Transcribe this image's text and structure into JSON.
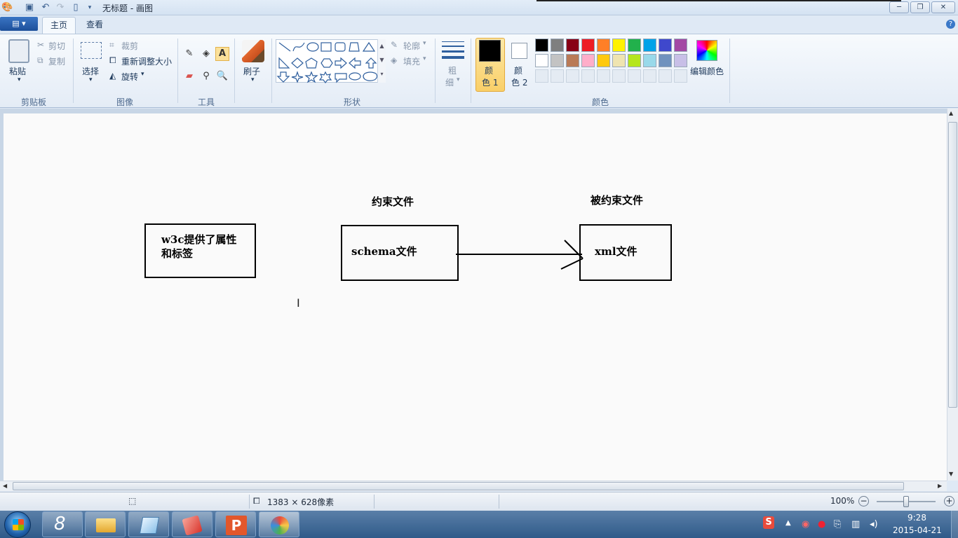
{
  "window": {
    "title": "无标题 - 画图"
  },
  "tabs": {
    "file": "▤ ▾",
    "home": "主页",
    "view": "查看"
  },
  "clipboard": {
    "paste": "粘贴",
    "cut": "剪切",
    "copy": "复制",
    "group": "剪贴板"
  },
  "image": {
    "select": "选择",
    "crop": "裁剪",
    "resize": "重新调整大小",
    "rotate": "旋转",
    "group": "图像"
  },
  "tools": {
    "group": "工具"
  },
  "brushes": {
    "label": "刷子"
  },
  "shapes": {
    "outline": "轮廓",
    "fill": "填充",
    "group": "形状"
  },
  "size": {
    "label1": "粗",
    "label2": "细"
  },
  "colors": {
    "color1_a": "颜",
    "color1_b": "色 1",
    "color2_a": "颜",
    "color2_b": "色 2",
    "edit": "编辑颜色",
    "group": "颜色",
    "color1": "#000000",
    "color2": "#ffffff",
    "palette_row1": [
      "#000000",
      "#7f7f7f",
      "#880015",
      "#ed1c24",
      "#ff7f27",
      "#fff200",
      "#22b14c",
      "#00a2e8",
      "#3f48cc",
      "#a349a4"
    ],
    "palette_row2": [
      "#ffffff",
      "#c3c3c3",
      "#b97a57",
      "#ffaec9",
      "#ffc90e",
      "#efe4b0",
      "#b5e61d",
      "#99d9ea",
      "#7092be",
      "#c8bfe7"
    ]
  },
  "drawing": {
    "label_constraint": "约束文件",
    "label_constrained": "被约束文件",
    "box1_line1": "w3c提供了属性",
    "box1_line2": "和标签",
    "box2": "schema文件",
    "box3": "xml文件"
  },
  "status": {
    "size": "1383 × 628像素",
    "zoom": "100%"
  },
  "taskbar": {
    "time": "9:28",
    "date": "2015-04-21"
  }
}
